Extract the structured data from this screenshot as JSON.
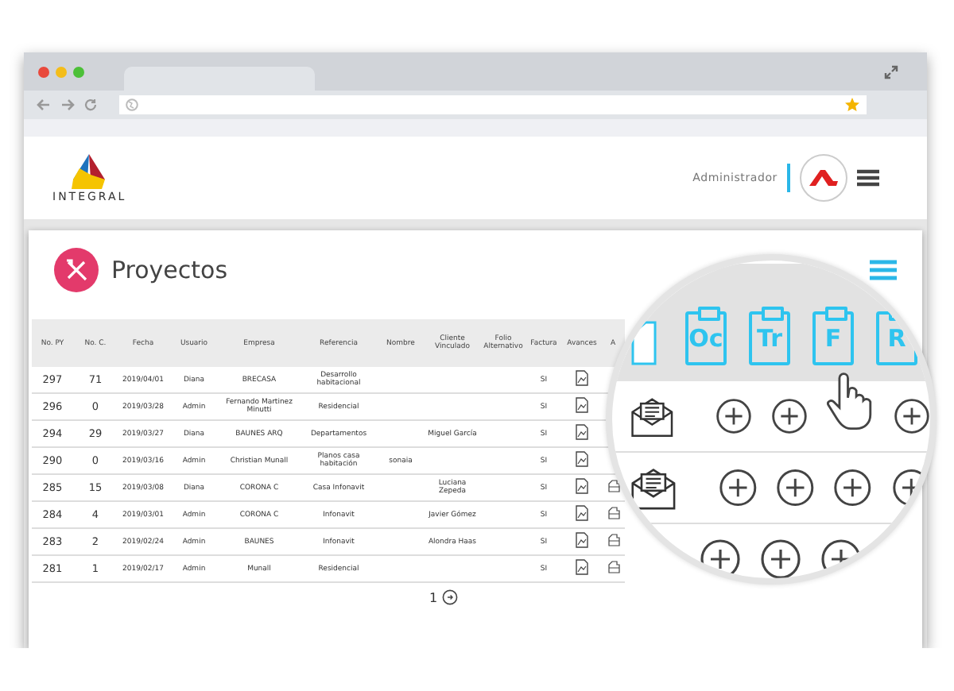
{
  "header": {
    "logo_text": "INTEGRAL",
    "user": "Administrador"
  },
  "page": {
    "title": "Proyectos"
  },
  "table": {
    "columns": [
      {
        "label": "No. PY",
        "kind": "text"
      },
      {
        "label": "No. C.",
        "kind": "text"
      },
      {
        "label": "Fecha",
        "kind": "text"
      },
      {
        "label": "Usuario",
        "kind": "text"
      },
      {
        "label": "Empresa",
        "kind": "text"
      },
      {
        "label": "Referencia",
        "kind": "text"
      },
      {
        "label": "Nombre",
        "kind": "text"
      },
      {
        "label": "Cliente Vinculado",
        "kind": "text"
      },
      {
        "label": "Folio Alternativo",
        "kind": "text"
      },
      {
        "label": "Factura",
        "kind": "text"
      },
      {
        "label": "Avances",
        "kind": "doc"
      },
      {
        "label": "A",
        "kind": "clip"
      }
    ],
    "rows": [
      {
        "cells": [
          "297",
          "71",
          "2019/04/01",
          "Diana",
          "BRECASA",
          "Desarrollo habitacional",
          null,
          null,
          null,
          "SI"
        ],
        "a": false
      },
      {
        "cells": [
          "296",
          "0",
          "2019/03/28",
          "Admin",
          "Fernando Martinez Minutti",
          "Residencial",
          null,
          null,
          null,
          "SI"
        ],
        "a": false
      },
      {
        "cells": [
          "294",
          "29",
          "2019/03/27",
          "Diana",
          "BAUNES ARQ",
          "Departamentos",
          null,
          "Miguel García",
          null,
          "SI"
        ],
        "a": false
      },
      {
        "cells": [
          "290",
          "0",
          "2019/03/16",
          "Admin",
          "Christian Munall",
          "Planos casa habitación",
          "sonaia",
          null,
          null,
          "SI"
        ],
        "a": false
      },
      {
        "cells": [
          "285",
          "15",
          "2019/03/08",
          "Diana",
          "CORONA C",
          "Casa Infonavit",
          null,
          "Luciana Zepeda",
          null,
          "SI"
        ],
        "a": true
      },
      {
        "cells": [
          "284",
          "4",
          "2019/03/01",
          "Admin",
          "CORONA C",
          "Infonavit",
          null,
          "Javier Gómez",
          null,
          "SI"
        ],
        "a": true
      },
      {
        "cells": [
          "283",
          "2",
          "2019/02/24",
          "Admin",
          "BAUNES",
          "Infonavit",
          null,
          "Alondra Haas",
          null,
          "SI"
        ],
        "a": true
      },
      {
        "cells": [
          "281",
          "1",
          "2019/02/17",
          "Admin",
          "Munall",
          "Residencial",
          null,
          null,
          null,
          "SI"
        ],
        "a": true
      }
    ]
  },
  "pagination": {
    "pages": [
      "1"
    ]
  },
  "magnifier": {
    "tabs": [
      "Oc",
      "Tr",
      "F",
      "R"
    ]
  }
}
